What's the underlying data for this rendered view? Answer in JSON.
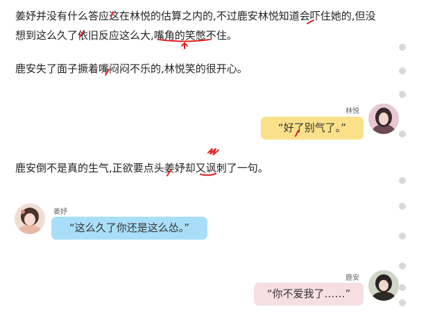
{
  "story": {
    "para1_line1": "姜妤并没有什么答应这在林悦的估算之内的,不过鹿安林悦知道会吓住她的,但没",
    "para1_line2": "想到这么久了依旧反应这么大,嘴角的笑憋不住。",
    "para2": "鹿安失了面子撅着嘴闷闷不乐的,林悦笑的很开心。",
    "para3": "鹿安倒不是真的生气,正欲要点头姜妤却又讽刺了一句。"
  },
  "chat": [
    {
      "speaker": "林悦",
      "text": "“好了别气了。”",
      "side": "right",
      "color": "#fbe08a"
    },
    {
      "speaker": "姜妤",
      "text": "“这么久了你还是这么怂。”",
      "side": "left",
      "color": "#a9def9"
    },
    {
      "speaker": "鹿安",
      "text": "“你不爱我了……”",
      "side": "right",
      "color": "#f6dfe1"
    }
  ],
  "colors": {
    "annotation_red": "#e02020",
    "scroll_dot": "#d8d8d8"
  }
}
